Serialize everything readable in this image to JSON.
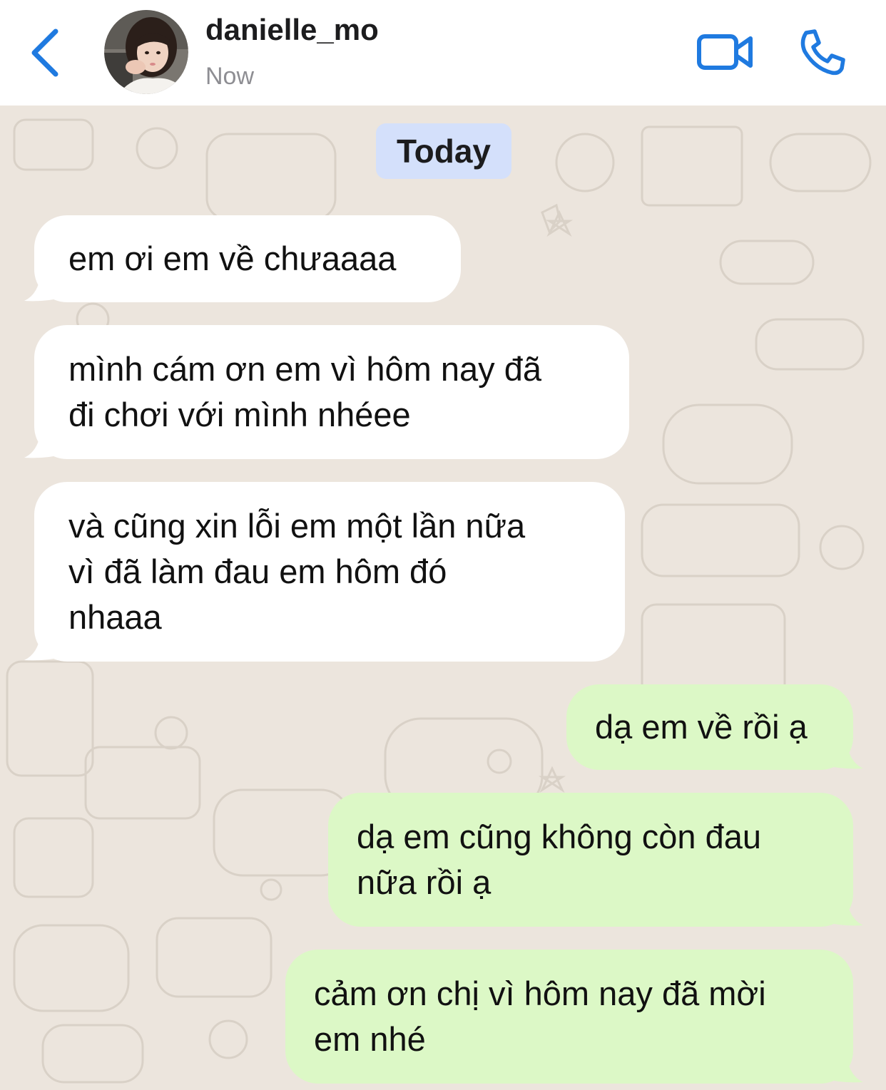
{
  "header": {
    "contact_name": "danielle_mo",
    "status": "Now",
    "back_icon": "chevron-left-icon",
    "video_icon": "video-camera-icon",
    "call_icon": "phone-icon",
    "accent_color": "#1f7ae0"
  },
  "chat": {
    "day_label": "Today",
    "incoming_color": "#ffffff",
    "outgoing_color": "#dcf8c6",
    "messages": [
      {
        "direction": "incoming",
        "text": "em ơi em về chưaaaa"
      },
      {
        "direction": "incoming",
        "text": "mình cám ơn em vì hôm nay đã\nđi chơi với mình nhéee"
      },
      {
        "direction": "incoming",
        "text": "và cũng xin lỗi em một lần nữa\nvì đã làm đau em hôm đó\nnhaaa"
      },
      {
        "direction": "outgoing",
        "text": "dạ em về rồi ạ"
      },
      {
        "direction": "outgoing",
        "text": "dạ em cũng không còn đau\nnữa rồi ạ"
      },
      {
        "direction": "outgoing",
        "text": "cảm ơn chị vì hôm nay đã mời\nem nhé"
      }
    ]
  }
}
